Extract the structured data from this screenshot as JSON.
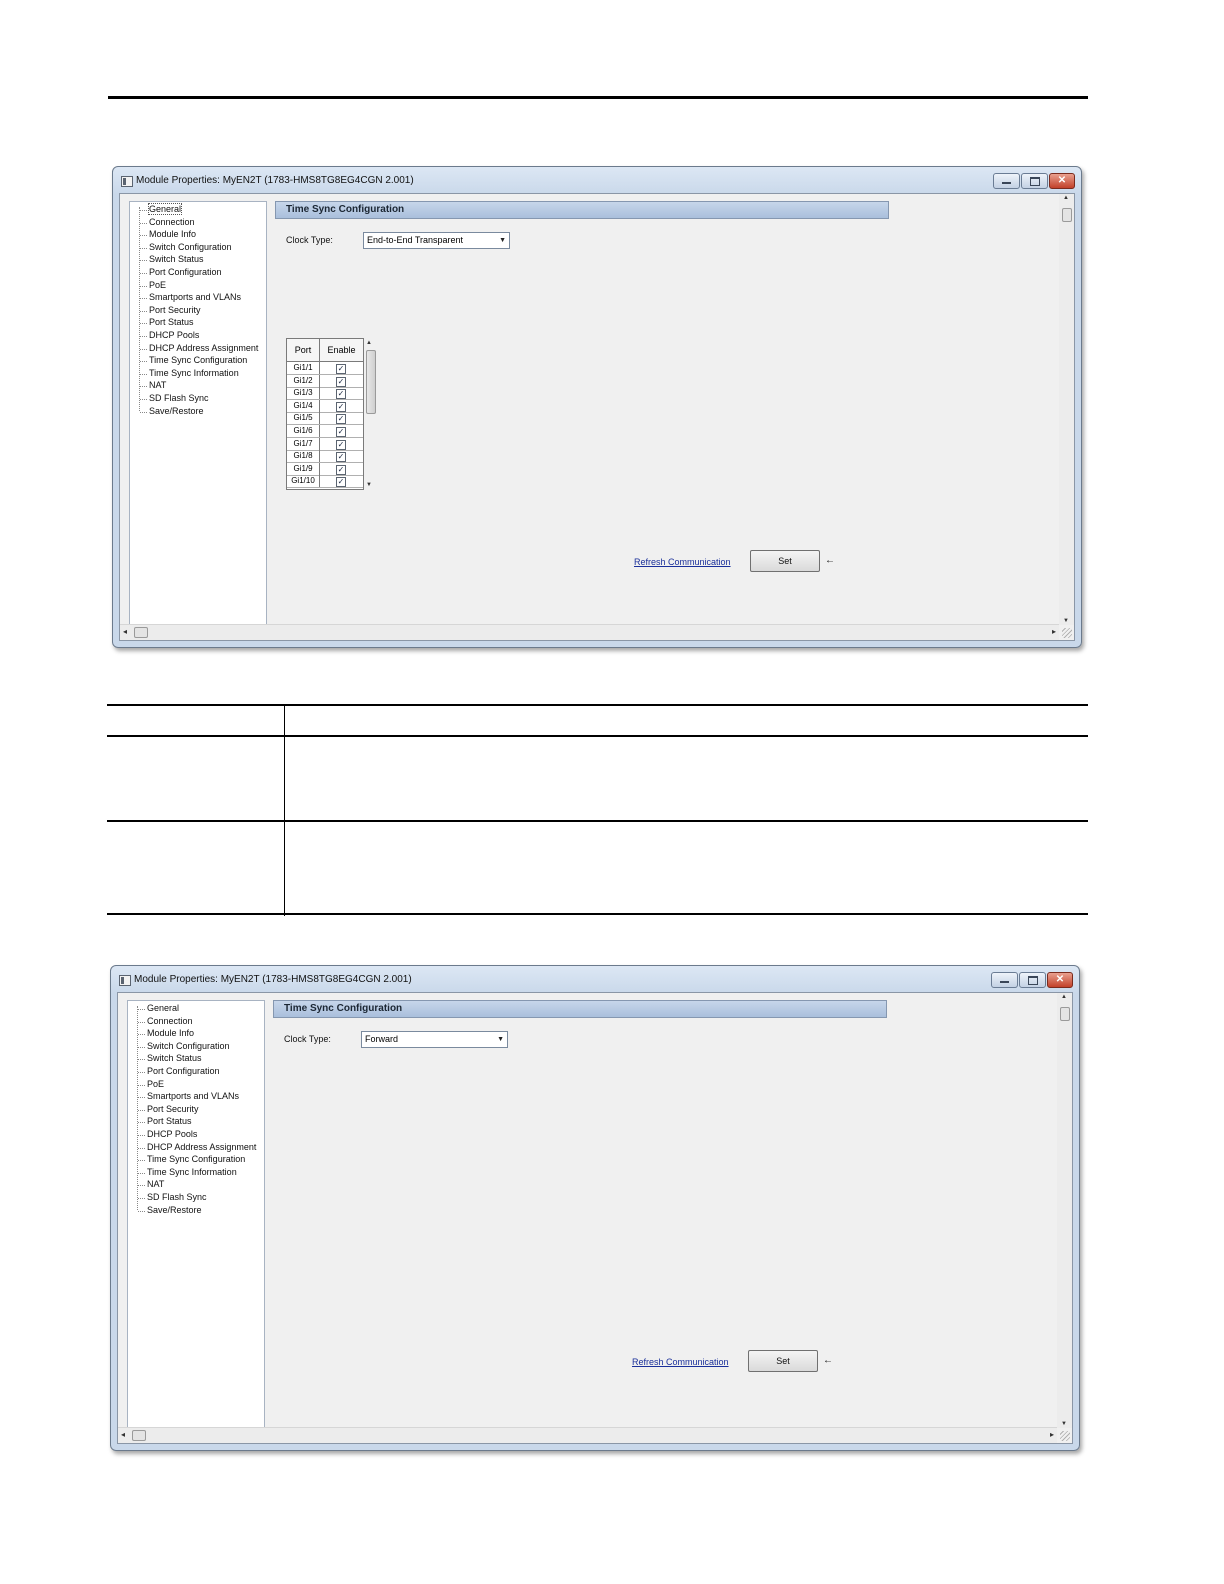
{
  "window": {
    "title": "Module Properties: MyEN2T (1783-HMS8TG8EG4CGN 2.001)"
  },
  "tree": {
    "items": [
      "General",
      "Connection",
      "Module Info",
      "Switch Configuration",
      "Switch Status",
      "Port Configuration",
      "PoE",
      "Smartports and VLANs",
      "Port Security",
      "Port Status",
      "DHCP Pools",
      "DHCP Address Assignment",
      "Time Sync Configuration",
      "Time Sync Information",
      "NAT",
      "SD Flash Sync",
      "Save/Restore"
    ]
  },
  "panel1": {
    "header": "Time Sync Configuration",
    "clock_type_label": "Clock Type:",
    "clock_type_value": "End-to-End Transparent",
    "grid": {
      "col_port": "Port",
      "col_enable": "Enable",
      "rows": [
        {
          "port": "Gi1/1",
          "enabled": true
        },
        {
          "port": "Gi1/2",
          "enabled": true
        },
        {
          "port": "Gi1/3",
          "enabled": true
        },
        {
          "port": "Gi1/4",
          "enabled": true
        },
        {
          "port": "Gi1/5",
          "enabled": true
        },
        {
          "port": "Gi1/6",
          "enabled": true
        },
        {
          "port": "Gi1/7",
          "enabled": true
        },
        {
          "port": "Gi1/8",
          "enabled": true
        },
        {
          "port": "Gi1/9",
          "enabled": true
        },
        {
          "port": "Gi1/10",
          "enabled": true
        }
      ]
    },
    "refresh_link": "Refresh Communication",
    "set_button": "Set",
    "arrow_glyph": "➜"
  },
  "panel2": {
    "header": "Time Sync Configuration",
    "clock_type_label": "Clock Type:",
    "clock_type_value": "Forward",
    "refresh_link": "Refresh Communication",
    "set_button": "Set",
    "arrow_glyph": "➜"
  },
  "glyphs": {
    "check": "✓",
    "combo_arrow": "▼",
    "scroll_up": "▲",
    "scroll_down": "▼",
    "scroll_left": "◂",
    "scroll_right": "▸",
    "minimize": "",
    "maximize": "",
    "close": "✕"
  }
}
